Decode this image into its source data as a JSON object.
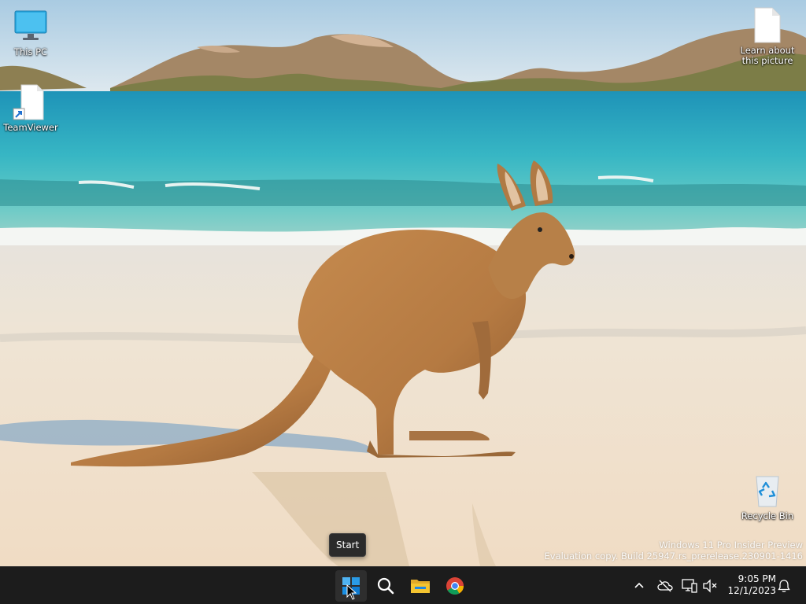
{
  "desktop": {
    "icons": {
      "this_pc": "This PC",
      "teamviewer": "TeamViewer",
      "learn_line1": "Learn about",
      "learn_line2": "this picture",
      "recycle_bin": "Recycle Bin"
    },
    "watermark": {
      "line1": "Windows 11 Pro Insider Preview",
      "line2": "Evaluation copy. Build 25947.rs_prerelease.230901-1416"
    },
    "tooltip": "Start"
  },
  "taskbar": {
    "apps": [
      "start-icon",
      "search-icon",
      "file-explorer-icon",
      "chrome-icon"
    ],
    "tray": [
      "chevron-up-icon",
      "cloud-off-icon",
      "network-icon",
      "volume-muted-icon",
      "notification-bell-icon"
    ],
    "clock": {
      "time": "9:05 PM",
      "date": "12/1/2023"
    }
  },
  "colors": {
    "taskbar_bg": "#1c1c1c",
    "start_blue": "#1a8fe3",
    "explorer_yellow": "#f4c430",
    "chrome_red": "#db4437",
    "chrome_green": "#0f9d58",
    "chrome_yellow": "#f4b400",
    "chrome_blue": "#4285f4"
  }
}
